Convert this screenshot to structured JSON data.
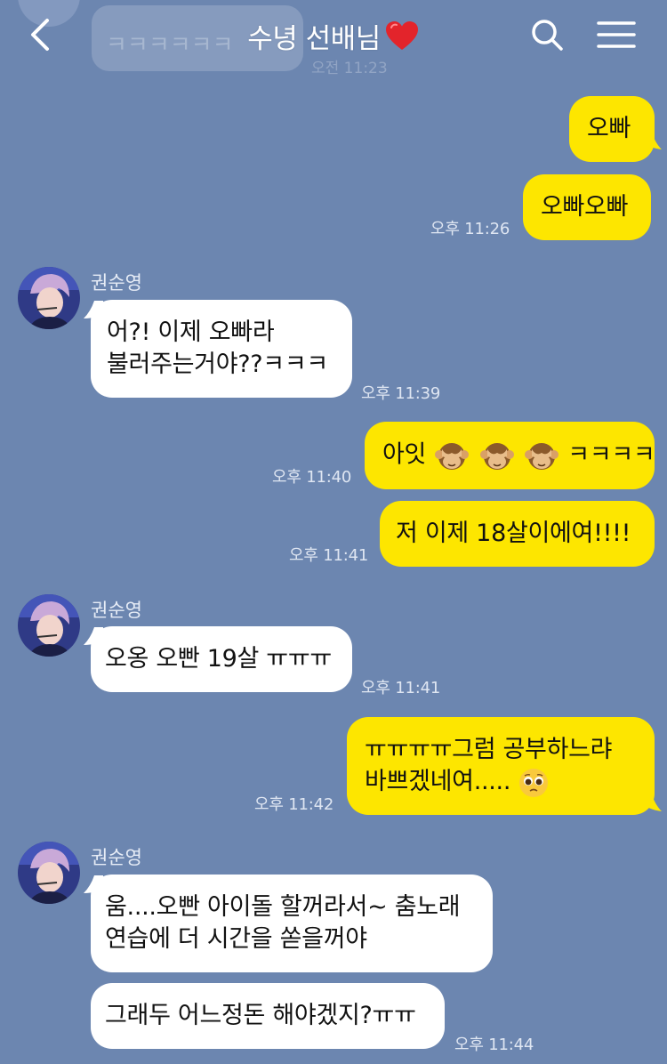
{
  "header": {
    "title": "수녕 선배님"
  },
  "colors": {
    "background": "#6c86b0",
    "outgoing_bubble": "#fde600",
    "incoming_bubble": "#ffffff"
  },
  "icons": {
    "back": "chevron-left-icon",
    "search": "search-icon",
    "menu": "hamburger-menu-icon",
    "heart": "red-heart-icon"
  },
  "previous": {
    "text": "ㅋㅋㅋㅋㅋㅋ",
    "time": "오전 11:23"
  },
  "messages": [
    {
      "from": "me",
      "text": "오빠"
    },
    {
      "from": "me",
      "text": "오빠오빠",
      "time": "오후 11:26"
    },
    {
      "from": "권순영",
      "sender": "권순영",
      "lines": [
        "어?! 이제 오빠라",
        "불러주는거야??ㅋㅋㅋ"
      ],
      "time": "오후 11:39"
    },
    {
      "from": "me",
      "text_start": "아잇",
      "text_end": "ㅋㅋㅋㅋ",
      "emoji": "see-no-evil-monkey x3",
      "time": "오후 11:40"
    },
    {
      "from": "me",
      "text": "저 이제 18살이에여!!!!",
      "time": "오후 11:41"
    },
    {
      "from": "권순영",
      "sender": "권순영",
      "text": "오옹 오빤 19살 ㅠㅠㅠ",
      "time": "오후 11:41"
    },
    {
      "from": "me",
      "lines": [
        "ㅠㅠㅠㅠ그럼 공부하느랴",
        "바쁘겠네여....."
      ],
      "emoji": "pleading-face",
      "time": "오후 11:42"
    },
    {
      "from": "권순영",
      "sender": "권순영",
      "lines": [
        "움....오빤 아이돌 할꺼라서~ 춤노래",
        "연습에 더 시간을 쏟을꺼야"
      ]
    },
    {
      "from": "권순영",
      "text": "그래두 어느정돈 해야겠지?ㅠㅠ",
      "time": "오후 11:44"
    }
  ]
}
